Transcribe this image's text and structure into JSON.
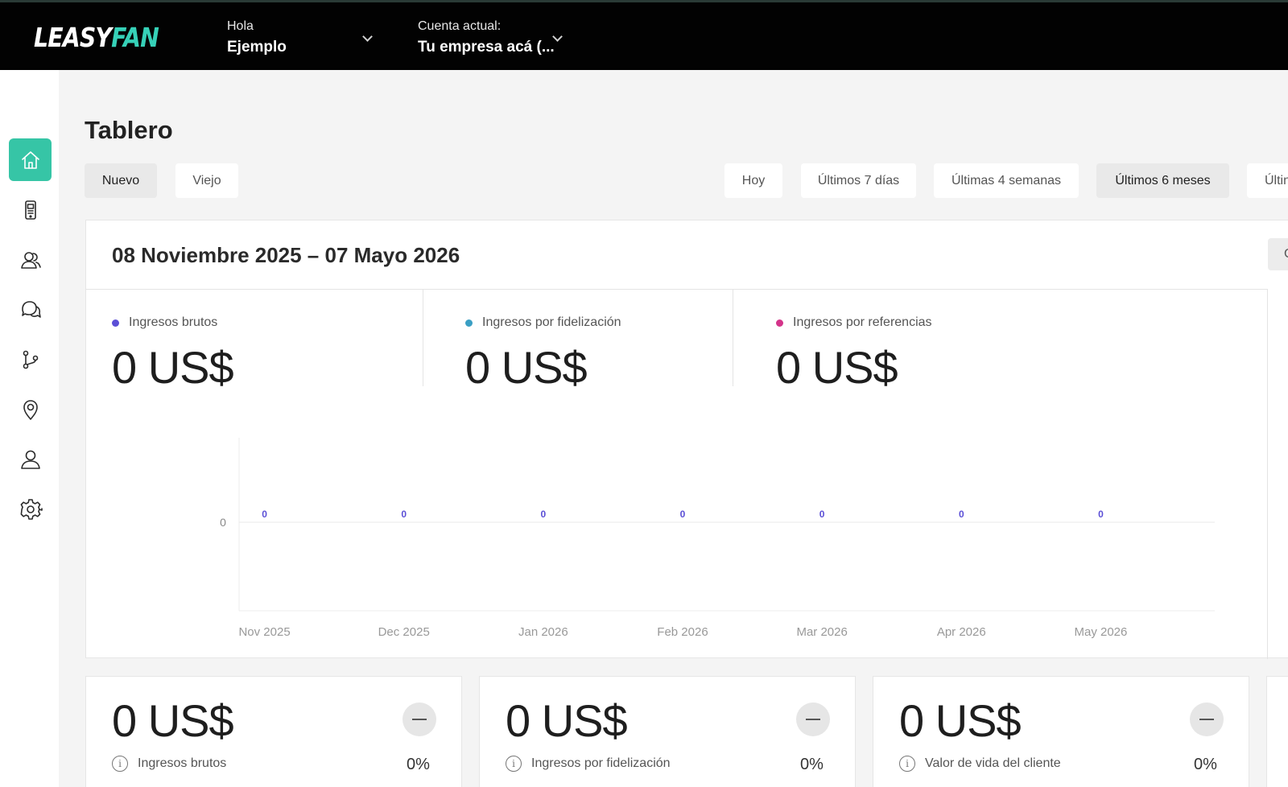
{
  "header": {
    "logo_left": "LEASY",
    "logo_right": "FAN",
    "greeting": "Hola",
    "user_name": "Ejemplo",
    "account_label": "Cuenta actual:",
    "account_name": "Tu empresa acá (..."
  },
  "sidebar": {
    "items": [
      {
        "icon": "home-icon",
        "active": true
      },
      {
        "icon": "device-icon"
      },
      {
        "icon": "users-icon"
      },
      {
        "icon": "chat-icon"
      },
      {
        "icon": "branch-icon"
      },
      {
        "icon": "location-icon"
      },
      {
        "icon": "user-icon"
      },
      {
        "icon": "gear-icon"
      }
    ]
  },
  "page": {
    "title": "Tablero",
    "version_tabs": [
      "Nuevo",
      "Viejo"
    ],
    "version_selected": "Nuevo",
    "range_tabs": [
      "Hoy",
      "Últimos 7 días",
      "Últimas 4 semanas",
      "Últimos 6 meses",
      "Últin"
    ],
    "range_selected": "Últimos 6 meses"
  },
  "summary": {
    "date_range": "08 Noviembre 2025 – 07 Mayo 2026",
    "corner_button": "C",
    "stats": [
      {
        "label": "Ingresos brutos",
        "value": "0 US$",
        "color": "#5b4fd6"
      },
      {
        "label": "Ingresos por fidelización",
        "value": "0 US$",
        "color": "#3a9fc4"
      },
      {
        "label": "Ingresos por referencias",
        "value": "0 US$",
        "color": "#d4348a"
      }
    ]
  },
  "chart_data": {
    "type": "line",
    "categories": [
      "Nov 2025",
      "Dec 2025",
      "Jan 2026",
      "Feb 2026",
      "Mar 2026",
      "Apr 2026",
      "May 2026"
    ],
    "series": [
      {
        "values": [
          0,
          0,
          0,
          0,
          0,
          0,
          0
        ],
        "color": "#5b4fd6"
      }
    ],
    "y_ticks": [
      "0"
    ],
    "ylim": [
      0,
      1
    ],
    "grid": true,
    "data_labels": true
  },
  "cards": [
    {
      "value": "0 US$",
      "label": "Ingresos brutos",
      "percent": "0%"
    },
    {
      "value": "0 US$",
      "label": "Ingresos por fidelización",
      "percent": "0%"
    },
    {
      "value": "0 US$",
      "label": "Valor de vida del cliente",
      "percent": "0%"
    }
  ]
}
